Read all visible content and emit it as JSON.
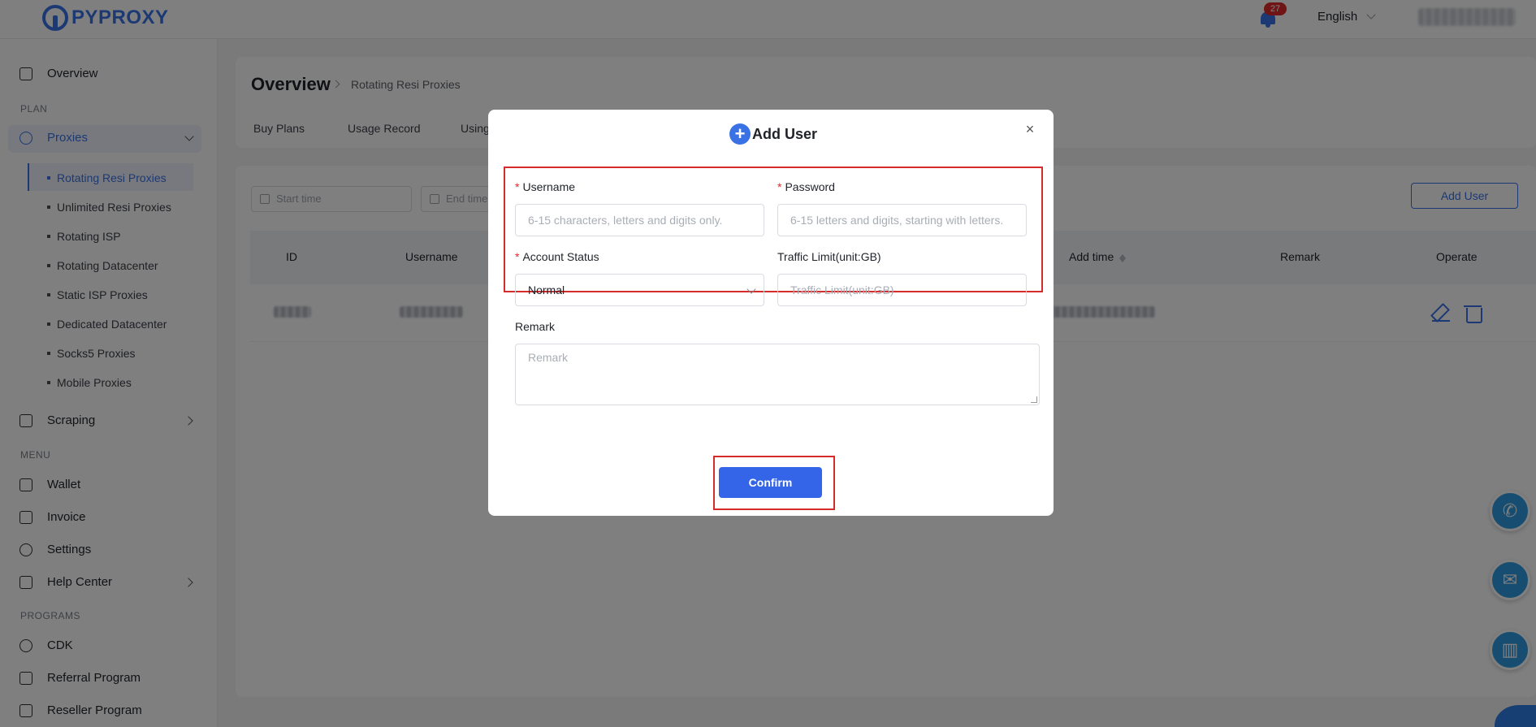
{
  "header": {
    "logo_text": "PYPROXY",
    "notification_count": "27",
    "language": "English"
  },
  "sidebar": {
    "overview": "Overview",
    "section_plan": "PLAN",
    "proxies": "Proxies",
    "sub_items": [
      "Rotating Resi Proxies",
      "Unlimited Resi Proxies",
      "Rotating ISP",
      "Rotating Datacenter",
      "Static ISP Proxies",
      "Dedicated Datacenter",
      "Socks5 Proxies",
      "Mobile Proxies"
    ],
    "scraping": "Scraping",
    "section_menu": "MENU",
    "wallet": "Wallet",
    "invoice": "Invoice",
    "settings": "Settings",
    "help_center": "Help Center",
    "section_programs": "PROGRAMS",
    "cdk": "CDK",
    "referral": "Referral Program",
    "reseller": "Reseller Program"
  },
  "main": {
    "title": "Overview",
    "breadcrumb": "Rotating Resi Proxies",
    "tabs": [
      "Buy Plans",
      "Usage Record",
      "Using"
    ],
    "start_time_placeholder": "Start time",
    "end_time_placeholder": "End time",
    "add_user_button": "Add User",
    "table_headers": {
      "id": "ID",
      "username": "Username",
      "add_time": "Add time",
      "remark": "Remark",
      "operate": "Operate"
    }
  },
  "modal": {
    "title": "Add User",
    "plus_glyph": "+",
    "close_glyph": "×",
    "username_label": "Username",
    "username_placeholder": "6-15 characters, letters and digits only.",
    "password_label": "Password",
    "password_placeholder": "6-15 letters and digits, starting with letters.",
    "account_status_label": "Account Status",
    "account_status_value": "Normal",
    "traffic_limit_label": "Traffic Limit(unit:GB)",
    "traffic_limit_placeholder": "Traffic Limit(unit:GB)",
    "remark_label": "Remark",
    "remark_placeholder": "Remark",
    "required_mark": "*",
    "confirm_button": "Confirm"
  },
  "colors": {
    "accent": "#3a72e6",
    "highlight_border": "#d62b2b",
    "badge": "#e02a2a"
  }
}
